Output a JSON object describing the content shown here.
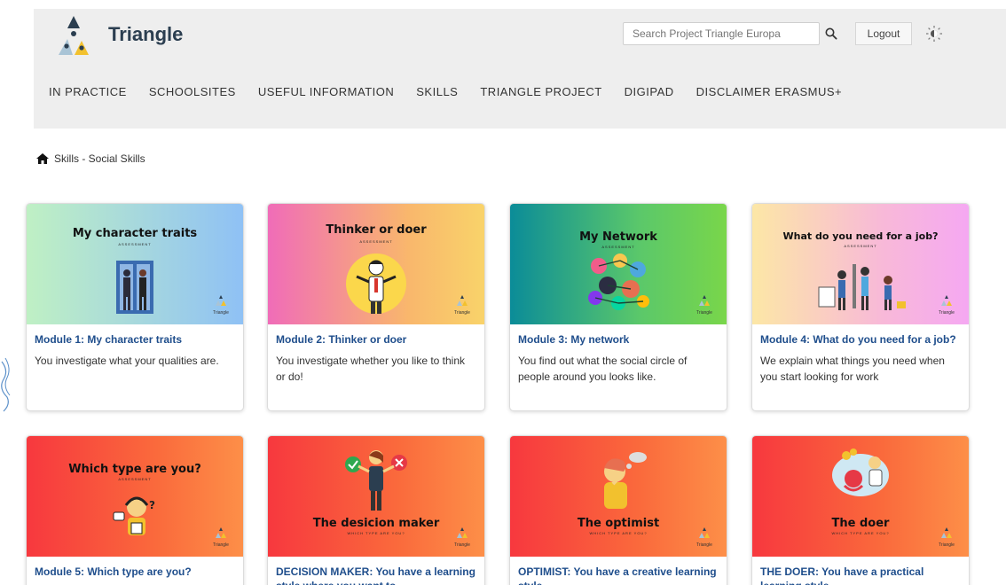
{
  "header": {
    "brand": "Triangle",
    "search_placeholder": "Search Project Triangle Europa",
    "logout_label": "Logout"
  },
  "nav": [
    "IN PRACTICE",
    "SCHOOLSITES",
    "USEFUL INFORMATION",
    "SKILLS",
    "TRIANGLE PROJECT",
    "DIGIPAD",
    "DISCLAIMER ERASMUS+"
  ],
  "breadcrumb": "Skills - Social Skills",
  "badge_text": "Triangle",
  "cards": [
    {
      "image_title": "My character traits",
      "image_sub": "ASSESSMENT",
      "title": "Module 1: My character traits",
      "desc": "You investigate what your qualities are."
    },
    {
      "image_title": "Thinker or doer",
      "image_sub": "ASSESSMENT",
      "title": "Module 2: Thinker or doer",
      "desc": "You investigate whether you like to think or do!"
    },
    {
      "image_title": "My Network",
      "image_sub": "ASSESSMENT",
      "title": "Module 3: My network",
      "desc": "You find out what the social circle of people around you looks like."
    },
    {
      "image_title": "What do you need for a job?",
      "image_sub": "ASSESSMENT",
      "title": "Module 4: What do you need for a job?",
      "desc": "We explain what things you need when you start looking for work"
    },
    {
      "image_title": "Which type are you?",
      "image_sub": "ASSESSMENT",
      "title": "Module 5: Which type are you?",
      "desc": ""
    },
    {
      "image_title": "The desicion maker",
      "image_sub": "WHICH TYPE ARE YOU?",
      "title": "DECISION MAKER: You have a learning style where you want to",
      "desc": ""
    },
    {
      "image_title": "The optimist",
      "image_sub": "WHICH TYPE ARE YOU?",
      "title": "OPTIMIST: You have a creative learning style",
      "desc": ""
    },
    {
      "image_title": "The doer",
      "image_sub": "WHICH TYPE ARE YOU?",
      "title": "THE DOER: You have a practical learning style",
      "desc": ""
    }
  ],
  "colors": {
    "nav_bg": "#eeeeee",
    "title_blue": "#1f4e8c",
    "card_red": "#f7383e"
  }
}
